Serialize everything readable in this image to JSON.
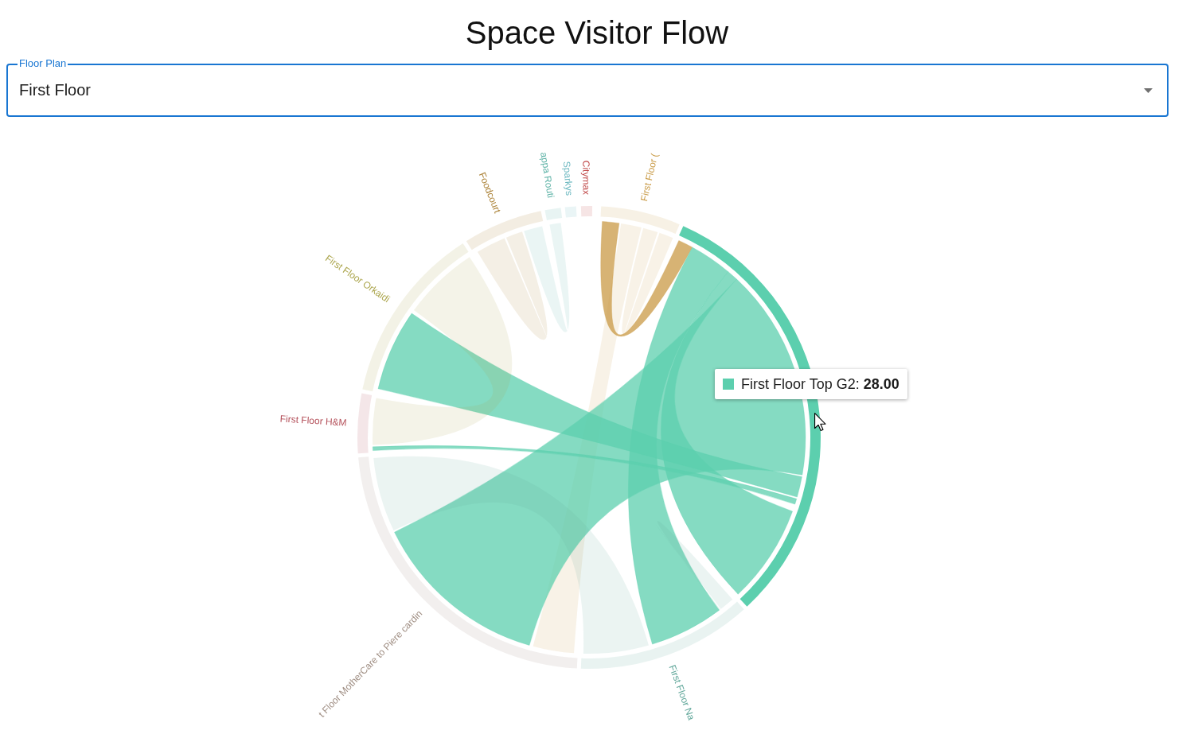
{
  "title": "Space Visitor Flow",
  "floor_select": {
    "label": "Floor Plan",
    "value": "First Floor"
  },
  "chord_diagram": {
    "groups": [
      {
        "label": "First Floor (",
        "color": "#c99a45",
        "selected": false
      },
      {
        "color": "#5ccfae",
        "selected": true
      },
      {
        "label": "First Floor Na",
        "color": "#62a89b",
        "selected": false
      },
      {
        "label": "t Floor MotherCare to Piere cardin",
        "color": "#a08f84",
        "selected": false
      },
      {
        "label": "First Floor H&M",
        "color": "#b4505a",
        "selected": false
      },
      {
        "label": "First Floor Orkaidi",
        "color": "#aca64e",
        "selected": false
      },
      {
        "label": "Foodcourt",
        "color": "#aa8035",
        "selected": false
      },
      {
        "label": "appa Routi",
        "color": "#5fb3a7",
        "selected": false
      },
      {
        "label": "Sparkys",
        "color": "#6cb8c0",
        "selected": false
      },
      {
        "label": "Citymax",
        "color": "#c04848",
        "selected": false
      }
    ],
    "tooltip": {
      "text": "First Floor Top G2: **28.00**"
    }
  }
}
